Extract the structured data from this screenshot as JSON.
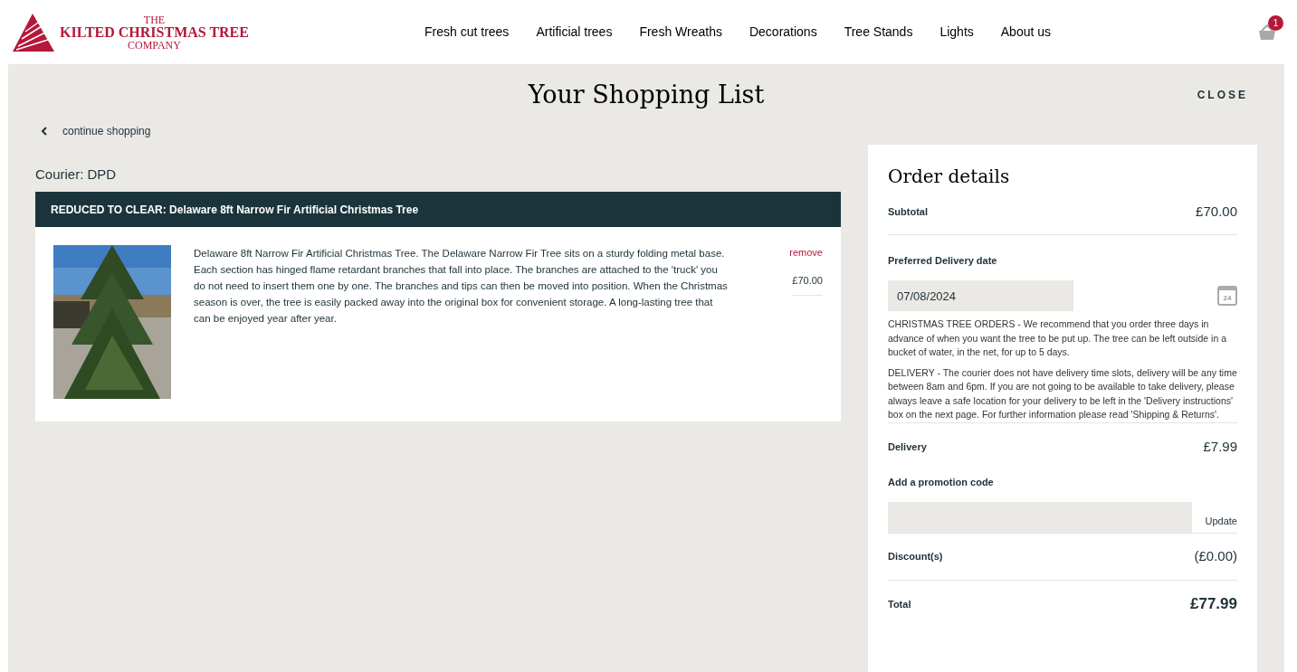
{
  "logo": {
    "lines": [
      "THE",
      "KILTED CHRISTMAS TREE",
      "COMPANY"
    ]
  },
  "nav": [
    "Fresh cut trees",
    "Artificial trees",
    "Fresh Wreaths",
    "Decorations",
    "Tree Stands",
    "Lights",
    "About us"
  ],
  "cart": {
    "count": "1"
  },
  "title": "Your Shopping List",
  "close": "CLOSE",
  "continue": "continue shopping",
  "courier": "Courier: DPD",
  "item": {
    "heading": "REDUCED TO CLEAR: Delaware 8ft Narrow Fir Artificial Christmas Tree",
    "description": "Delaware 8ft Narrow Fir Artificial Christmas Tree. The Delaware Narrow Fir Tree sits on a sturdy folding metal base. Each section has hinged flame retardant branches that fall into place. The branches are attached to the 'truck' you do not need to insert them one by one. The branches and tips can then be moved into position. When the Christmas season is over, the tree is easily packed away into the original box for convenient storage. A long-lasting tree that can be enjoyed year after year.",
    "remove": "remove",
    "price": "£70.00"
  },
  "order": {
    "title": "Order details",
    "subtotal_label": "Subtotal",
    "subtotal": "£70.00",
    "date_label": "Preferred Delivery date",
    "date": "07/08/2024",
    "calendar_day": "24",
    "notes": [
      "CHRISTMAS TREE ORDERS - We recommend that you order three days in advance of when you want the tree to be put up. The tree can be left outside in a bucket of water, in the net, for up to 5 days.",
      "DELIVERY - The courier does not have delivery time slots, delivery will be any time between 8am and 6pm. If you are not going to be available to take delivery, please always leave a safe location for your delivery to be left in the 'Delivery instructions' box on the next page. For further information please read 'Shipping & Returns'."
    ],
    "delivery_label": "Delivery",
    "delivery": "£7.99",
    "promo_label": "Add a promotion code",
    "update": "Update",
    "discount_label": "Discount(s)",
    "discount": "(£0.00)",
    "total_label": "Total",
    "total": "£77.99"
  }
}
